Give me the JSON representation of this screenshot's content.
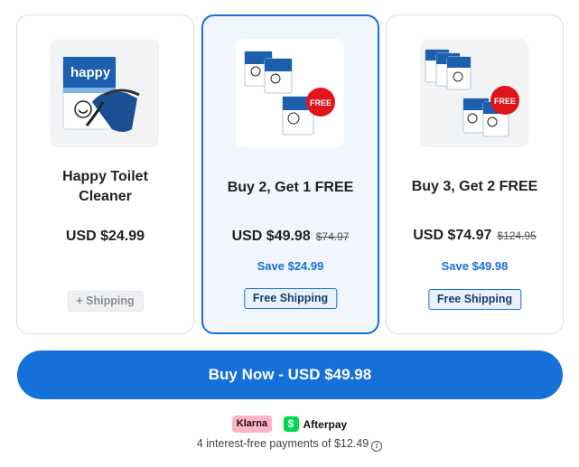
{
  "offers": [
    {
      "title": "Happy Toilet Cleaner",
      "price": "USD $24.99",
      "old_price": "",
      "save": "",
      "shipping": "+ Shipping",
      "image_icon": "product-box-with-tablet-icon",
      "selected": false
    },
    {
      "title": "Buy 2, Get 1 FREE",
      "price": "USD $49.98",
      "old_price": "$74.97",
      "save": "Save $24.99",
      "shipping": "Free Shipping",
      "image_icon": "three-boxes-free-badge-icon",
      "free_badge": "FREE",
      "selected": true
    },
    {
      "title": "Buy 3, Get 2 FREE",
      "price": "USD $74.97",
      "old_price": "$124.95",
      "save": "Save $49.98",
      "shipping": "Free Shipping",
      "image_icon": "five-boxes-free-badge-icon",
      "free_badge": "FREE",
      "selected": false
    }
  ],
  "product_box_text": "happy",
  "buy_button": "Buy Now - USD $49.98",
  "payment": {
    "klarna": "Klarna",
    "cashapp_symbol": "$",
    "afterpay": "Afterpay",
    "installments": "4 interest-free payments of $12.49"
  },
  "colors": {
    "accent": "#1670d9",
    "selected_bg": "#f0f6fc",
    "klarna_pink": "#ffb3c7",
    "cashapp_green": "#00d64f",
    "free_badge_red": "#e0151c"
  }
}
